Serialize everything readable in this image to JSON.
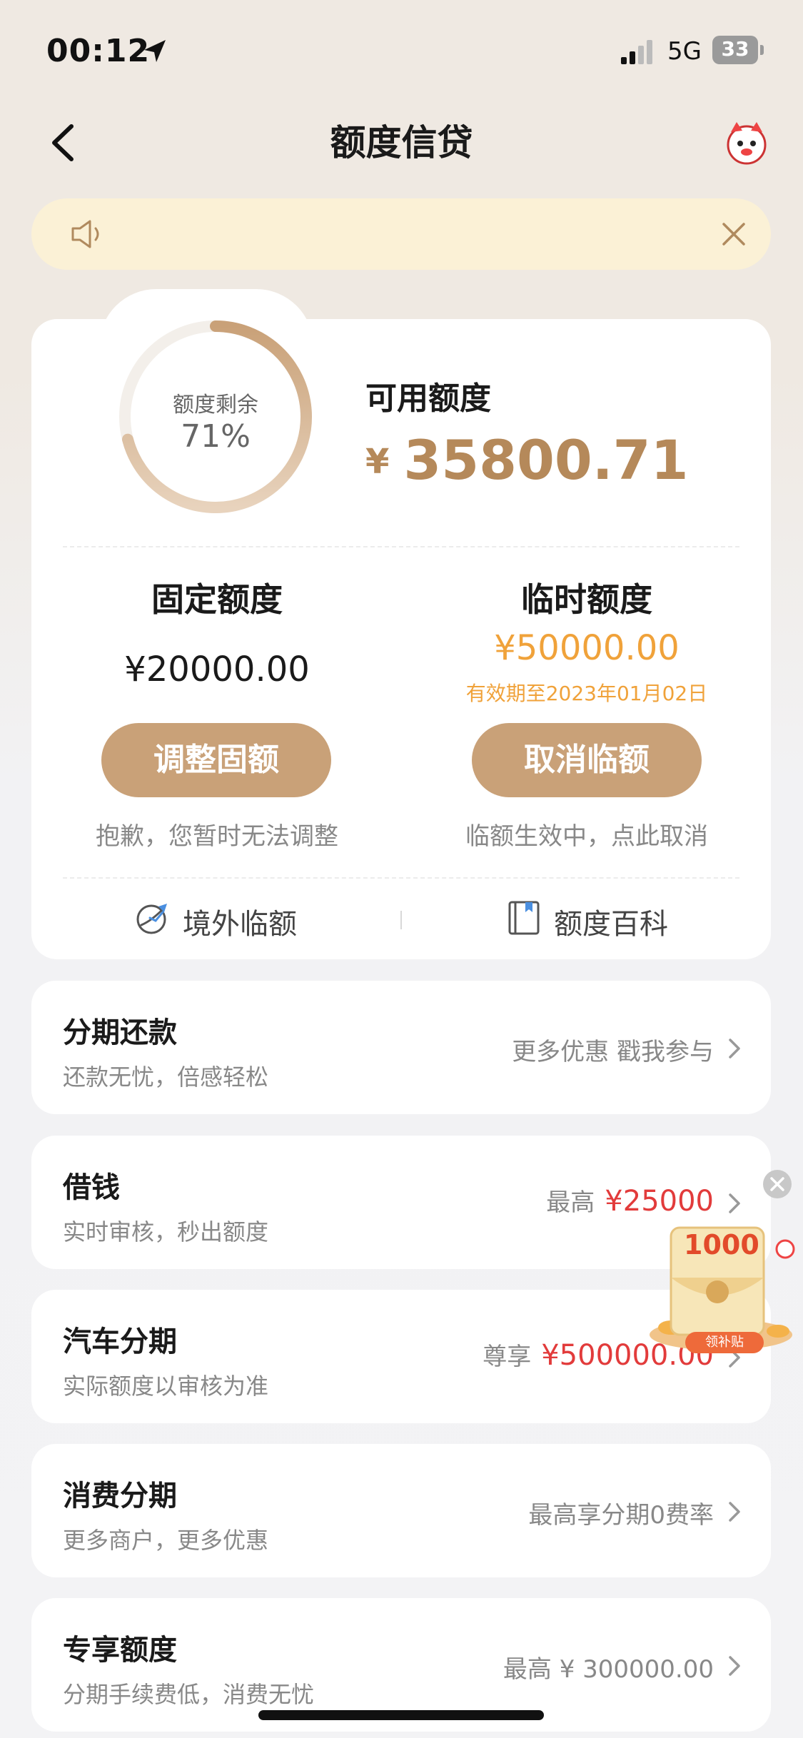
{
  "status_bar": {
    "time": "00:12",
    "network": "5G",
    "battery": "33"
  },
  "header": {
    "title": "额度信贷"
  },
  "notice": {
    "text": ""
  },
  "credit": {
    "ring_label": "额度剩余",
    "ring_percent": "71%",
    "ring_fraction": 0.71,
    "available_label": "可用额度",
    "available_currency": "¥",
    "available_amount": "35800.71",
    "fixed_title": "固定额度",
    "fixed_amount": "¥20000.00",
    "temp_title": "临时额度",
    "temp_amount": "¥50000.00",
    "temp_expiry": "有效期至2023年01月02日",
    "adjust_button": "调整固额",
    "cancel_button": "取消临额",
    "adjust_hint": "抱歉，您暂时无法调整",
    "cancel_hint": "临额生效中，点此取消",
    "links": [
      {
        "label": "境外临额",
        "icon": "globe-plane-icon"
      },
      {
        "label": "额度百科",
        "icon": "book-icon"
      }
    ]
  },
  "services": [
    {
      "title": "分期还款",
      "subtitle": "还款无忧，倍感轻松",
      "right_text": "更多优惠 戳我参与",
      "highlight": ""
    },
    {
      "title": "借钱",
      "subtitle": "实时审核，秒出额度",
      "right_text": "最高",
      "highlight": "¥25000"
    },
    {
      "title": "汽车分期",
      "subtitle": "实际额度以审核为准",
      "right_text": "尊享",
      "highlight": "¥500000.00"
    },
    {
      "title": "消费分期",
      "subtitle": "更多商户，更多优惠",
      "right_text": "最高享分期0费率",
      "highlight": ""
    },
    {
      "title": "专享额度",
      "subtitle": "分期手续费低，消费无忧",
      "right_text": "最高 ¥ 300000.00",
      "highlight": ""
    }
  ],
  "float_ad": {
    "amount": "1000",
    "label": "领补贴"
  },
  "colors": {
    "accent": "#c9a178",
    "gold_text": "#b5895a",
    "temp_orange": "#f0a23a",
    "highlight_red": "#e23b3b",
    "notice_bg": "#fbf1d6"
  }
}
